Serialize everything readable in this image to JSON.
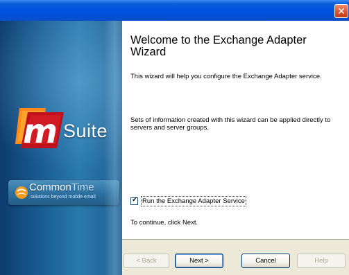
{
  "window": {
    "close_glyph": "✕"
  },
  "banner": {
    "product_letter": "m",
    "product_suffix": "Suite",
    "company_part1": "Common",
    "company_part2": "Time",
    "company_tagline": "solutions beyond mobile email"
  },
  "content": {
    "heading": "Welcome to the Exchange Adapter Wizard",
    "intro": "This wizard will help you configure the Exchange Adapter service.",
    "sets_info": "Sets of information created with this wizard can be applied directly to servers and server groups.",
    "checkbox_label": "Run the Exchange Adapter Service",
    "checkbox_checked": true,
    "checkbox_mark": "✓",
    "continue_text": "To continue, click Next."
  },
  "buttons": {
    "back": "< Back",
    "next": "Next >",
    "cancel": "Cancel",
    "help": "Help"
  },
  "colors": {
    "titlebar": "#0054e3",
    "banner": "#1a5d93",
    "button_border": "#003c74"
  }
}
